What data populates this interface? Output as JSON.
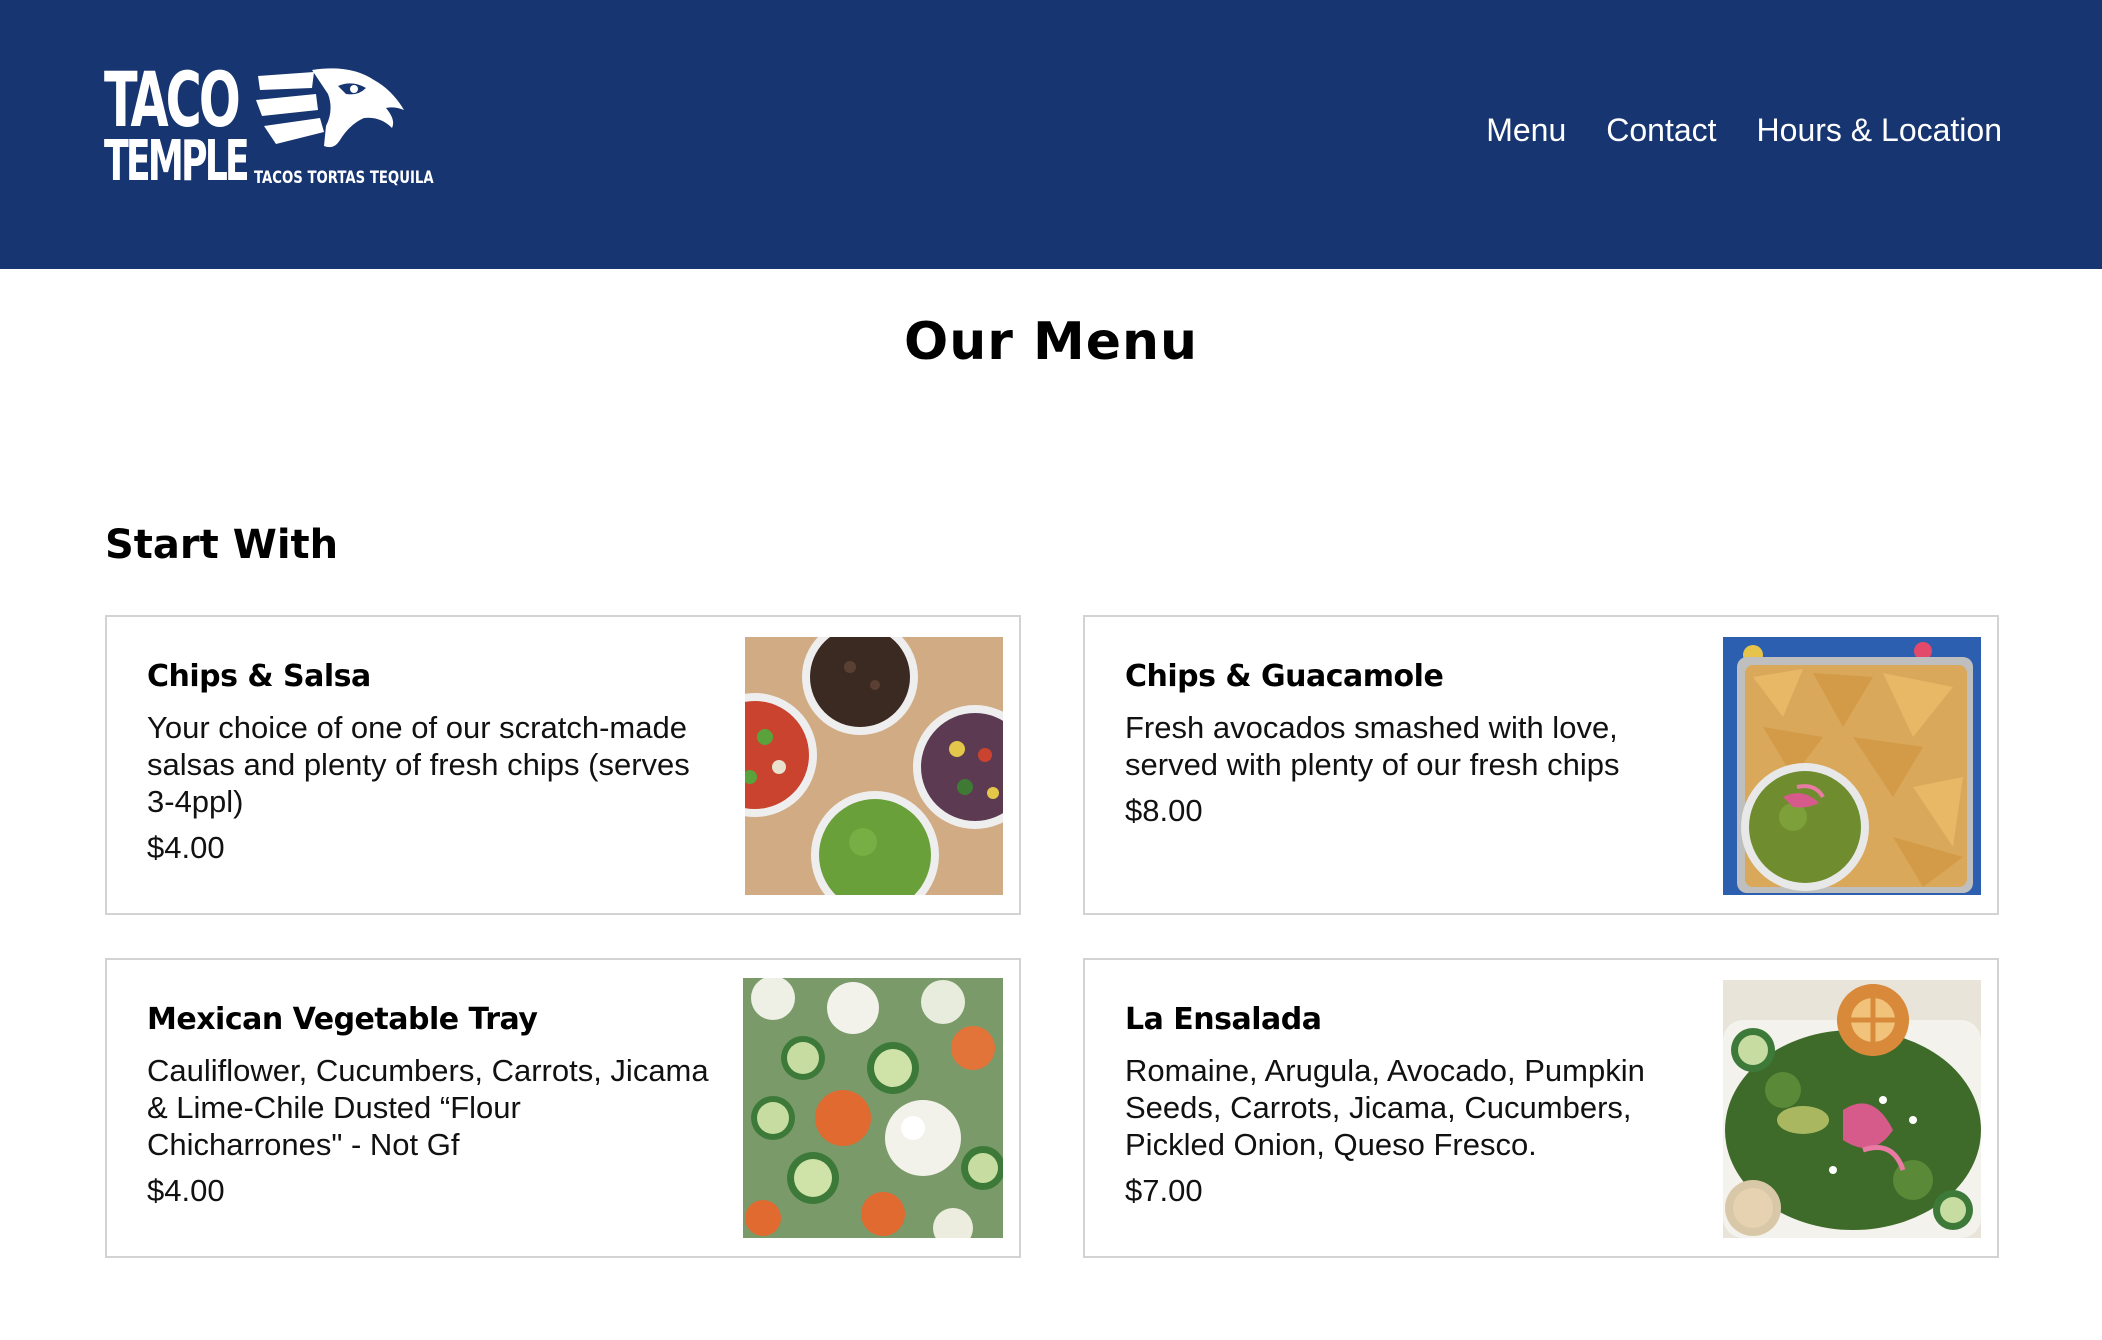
{
  "header": {
    "logo": {
      "line1": "TACO",
      "line2": "TEMPLE",
      "tagline": "TACOS TORTAS TEQUILA"
    },
    "nav": [
      {
        "label": "Menu"
      },
      {
        "label": "Contact"
      },
      {
        "label": "Hours & Location"
      }
    ]
  },
  "page": {
    "title": "Our Menu"
  },
  "sections": [
    {
      "title": "Start With",
      "items": [
        {
          "name": "Chips & Salsa",
          "description": "Your choice of one of our scratch-made salsas and plenty of fresh chips (serves 3-4ppl)",
          "price": "$4.00",
          "image": "salsa-bowls-photo"
        },
        {
          "name": "Chips & Guacamole",
          "description": "Fresh avocados smashed with love, served with plenty of our fresh chips",
          "price": "$8.00",
          "image": "chips-guacamole-photo"
        },
        {
          "name": "Mexican Vegetable Tray",
          "description": "Cauliflower, Cucumbers, Carrots, Jicama & Lime-Chile Dusted “Flour Chicharrones\" - Not Gf",
          "price": "$4.00",
          "image": "vegetable-tray-photo"
        },
        {
          "name": "La Ensalada",
          "description": "Romaine, Arugula, Avocado, Pumpkin Seeds, Carrots, Jicama, Cucumbers, Pickled Onion, Queso Fresco.",
          "price": "$7.00",
          "image": "salad-photo"
        }
      ]
    }
  ],
  "colors": {
    "header_bg": "#173570",
    "nav_text": "#ffffff",
    "card_border": "#d3d3d3"
  }
}
